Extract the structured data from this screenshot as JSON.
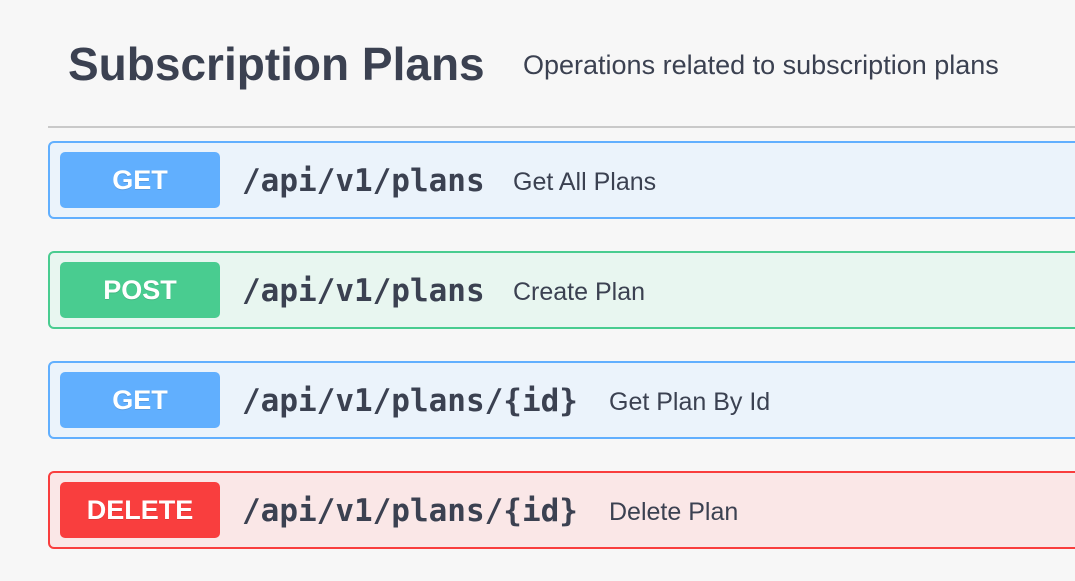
{
  "section": {
    "title": "Subscription Plans",
    "description": "Operations related to subscription plans"
  },
  "operations": [
    {
      "method": "GET",
      "path": "/api/v1/plans",
      "summary": "Get All Plans"
    },
    {
      "method": "POST",
      "path": "/api/v1/plans",
      "summary": "Create Plan"
    },
    {
      "method": "GET",
      "path": "/api/v1/plans/{id}",
      "summary": "Get Plan By Id"
    },
    {
      "method": "DELETE",
      "path": "/api/v1/plans/{id}",
      "summary": "Delete Plan"
    }
  ],
  "colors": {
    "get": "#61affe",
    "post": "#49cc90",
    "delete": "#f93e3e",
    "text": "#3b4151"
  }
}
